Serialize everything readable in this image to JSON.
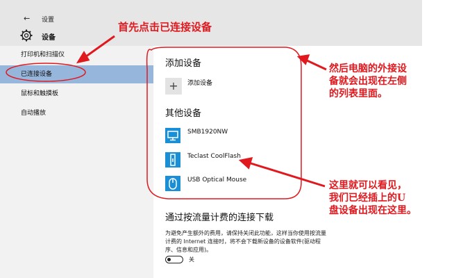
{
  "window": {
    "back_glyph": "←",
    "title": "设置"
  },
  "page": {
    "title": "设备"
  },
  "sidebar": {
    "items": [
      {
        "label": "打印机和扫描仪"
      },
      {
        "label": "已连接设备"
      },
      {
        "label": "鼠标和触摸板"
      },
      {
        "label": "自动播放"
      }
    ]
  },
  "main": {
    "add_heading": "添加设备",
    "add_button": "添加设备",
    "other_heading": "其他设备",
    "devices": [
      {
        "name": "SMB1920NW",
        "icon": "monitor-icon"
      },
      {
        "name": "Teclast CoolFlash",
        "icon": "usb-drive-icon"
      },
      {
        "name": "USB Optical Mouse",
        "icon": "mouse-icon"
      }
    ],
    "metered_heading": "通过按流量计费的连接下载",
    "metered_desc_lines": [
      "为避免产生额外的费用，请保持关闭此功能，这样当你使用按流量",
      "计费的 Internet 连接时，将不会下载新设备的设备软件(驱动程",
      "序、信息和应用)。"
    ],
    "toggle_label": "关",
    "toggle_state": "off"
  },
  "annotations": {
    "first_click": "首先点击已连接设备",
    "after_lines": [
      "然后电脑的外接设",
      "备就会出现在左侧",
      "的列表里面。"
    ],
    "here_lines": [
      "这里就可以看见，",
      "我们已经插上的U",
      "盘设备出现在这里。"
    ],
    "color": "#e0191f"
  }
}
